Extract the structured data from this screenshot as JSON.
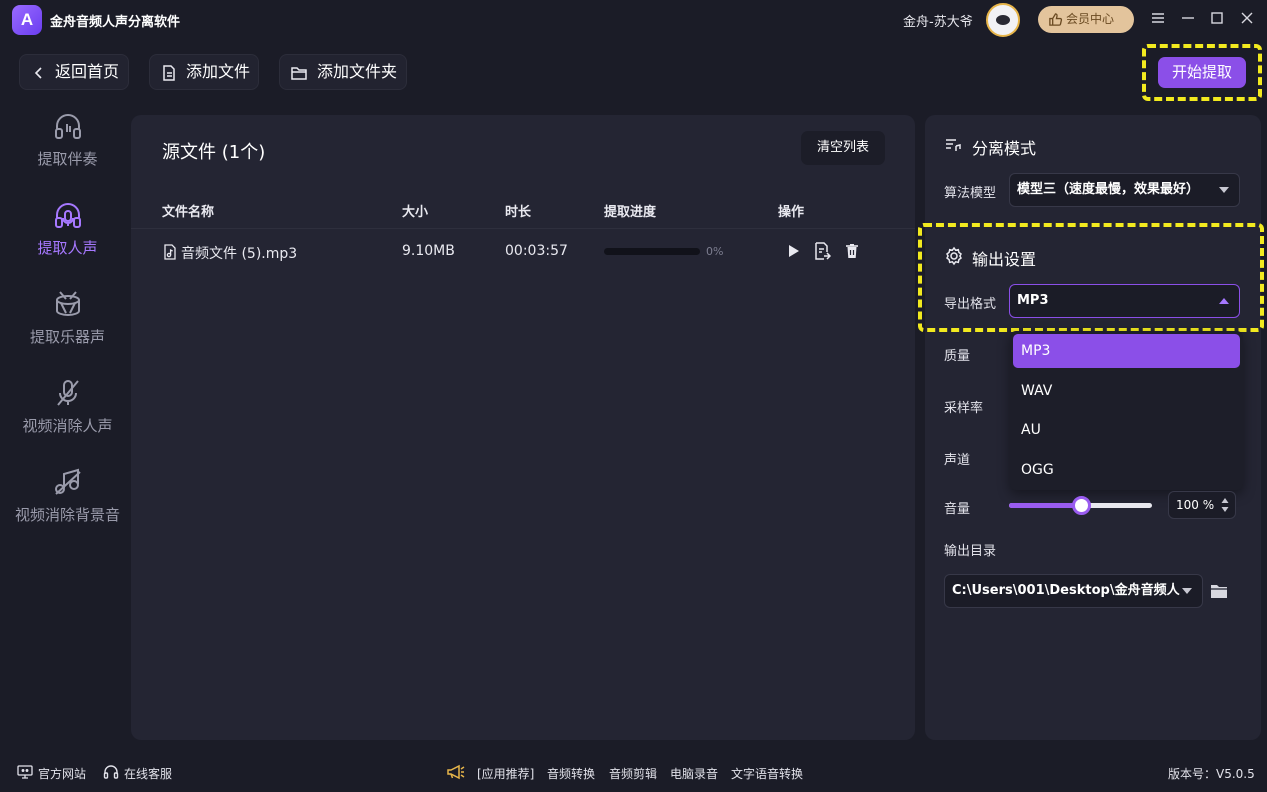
{
  "app": {
    "title": "金舟音频人声分离软件",
    "logo_letter": "A"
  },
  "user": {
    "name": "金舟-苏大爷",
    "vip_label": "会员中心"
  },
  "toolbar": {
    "back": "返回首页",
    "add_file": "添加文件",
    "add_folder": "添加文件夹",
    "start": "开始提取"
  },
  "sidebar": {
    "items": [
      {
        "label": "提取伴奏",
        "icon": "headphones-icon",
        "active": false
      },
      {
        "label": "提取人声",
        "icon": "headset-mic-icon",
        "active": true
      },
      {
        "label": "提取乐器声",
        "icon": "drum-icon",
        "active": false
      },
      {
        "label": "视频消除人声",
        "icon": "mic-off-icon",
        "active": false
      },
      {
        "label": "视频消除背景音",
        "icon": "music-off-icon",
        "active": false
      }
    ]
  },
  "source": {
    "title": "源文件 (1个)",
    "clear_label": "清空列表",
    "columns": [
      "文件名称",
      "大小",
      "时长",
      "提取进度",
      "操作"
    ],
    "rows": [
      {
        "name": "音频文件 (5).mp3",
        "size": "9.10MB",
        "duration": "00:03:57",
        "progress": 0,
        "progress_text": "0%"
      }
    ]
  },
  "separation": {
    "title": "分离模式",
    "model_label": "算法模型",
    "model_value": "模型三（速度最慢，效果最好）"
  },
  "output": {
    "title": "输出设置",
    "format_label": "导出格式",
    "format_value": "MP3",
    "format_options": [
      "MP3",
      "WAV",
      "AU",
      "OGG"
    ],
    "quality_label": "质量",
    "samplerate_label": "采样率",
    "channel_label": "声道",
    "volume_label": "音量",
    "volume_percent": 100,
    "volume_value": "100",
    "volume_unit": "%",
    "dir_label": "输出目录",
    "dir_value": "C:\\Users\\001\\Desktop\\金舟音频人"
  },
  "footer": {
    "website": "官方网站",
    "support": "在线客服",
    "recommend": "[应用推荐]",
    "links": [
      "音频转换",
      "音频剪辑",
      "电脑录音",
      "文字语音转换"
    ],
    "version": "版本号：V5.0.5"
  },
  "colors": {
    "accent": "#8b4fe8",
    "highlight": "#f2ea1f",
    "background": "#1b1c27",
    "panel": "#242533"
  }
}
